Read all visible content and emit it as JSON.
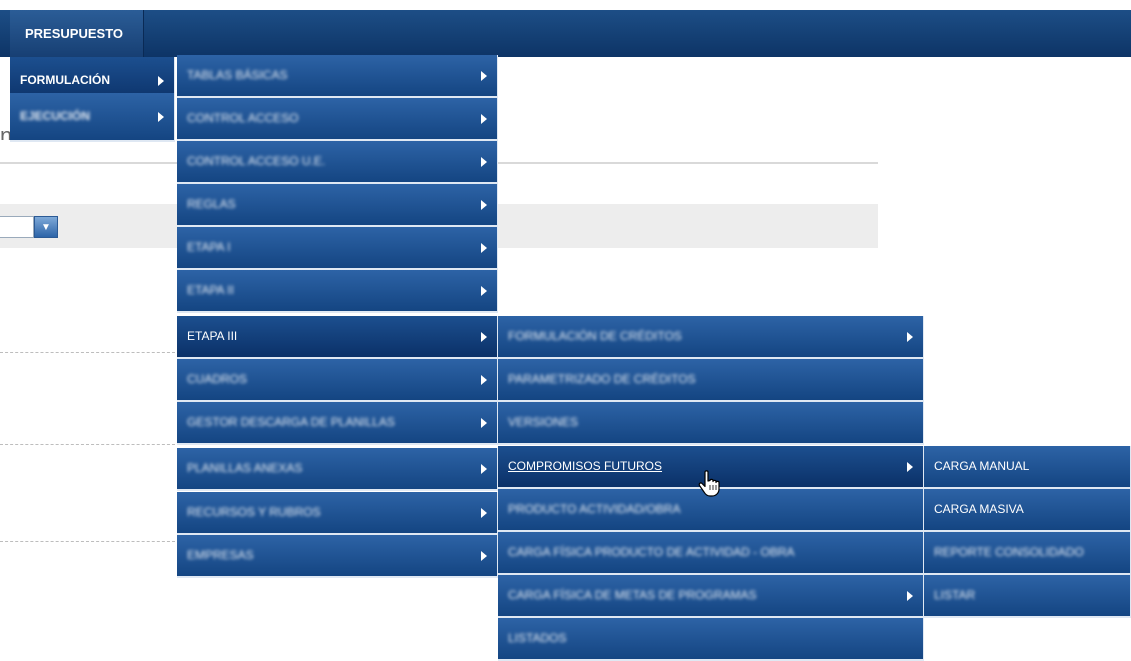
{
  "colors": {
    "menu_bg": "#1f5596",
    "banner_bg": "#123d73",
    "menu_text": "#ffffff"
  },
  "topbar": {
    "tab_label": "PRESUPUESTO"
  },
  "background_page": {
    "heading_fragment": "nperadas",
    "select_arrow_icon": "chevron-down-icon"
  },
  "menu_level1": [
    {
      "label": "FORMULACIÓN",
      "has_submenu": true,
      "active": true
    },
    {
      "label": "EJECUCIÓN",
      "has_submenu": true,
      "active": false
    }
  ],
  "menu_level2": [
    {
      "label": "TABLAS BÁSICAS",
      "has_submenu": true
    },
    {
      "label": "CONTROL ACCESO",
      "has_submenu": true
    },
    {
      "label": "CONTROL ACCESO U.E.",
      "has_submenu": true
    },
    {
      "label": "REGLAS",
      "has_submenu": true
    },
    {
      "label": "ETAPA I",
      "has_submenu": true
    },
    {
      "label": "ETAPA II",
      "has_submenu": true
    },
    {
      "label": "ETAPA III",
      "has_submenu": true,
      "active": true
    },
    {
      "label": "CUADROS",
      "has_submenu": true
    },
    {
      "label": "GESTOR DESCARGA DE PLANILLAS",
      "has_submenu": true
    },
    {
      "label": "PLANILLAS ANEXAS",
      "has_submenu": true
    },
    {
      "label": "RECURSOS Y RUBROS",
      "has_submenu": true
    },
    {
      "label": "EMPRESAS",
      "has_submenu": true
    }
  ],
  "menu_level3": [
    {
      "label": "FORMULACIÓN DE CRÉDITOS",
      "has_submenu": true
    },
    {
      "label": "PARAMETRIZADO DE CRÉDITOS",
      "has_submenu": false
    },
    {
      "label": "VERSIONES",
      "has_submenu": false
    },
    {
      "label": "COMPROMISOS FUTUROS",
      "has_submenu": true,
      "active": true
    },
    {
      "label": "PRODUCTO ACTIVIDAD/OBRA",
      "has_submenu": false
    },
    {
      "label": "CARGA FÍSICA PRODUCTO DE ACTIVIDAD - OBRA",
      "has_submenu": false
    },
    {
      "label": "CARGA FÍSICA DE METAS DE PROGRAMAS",
      "has_submenu": true
    },
    {
      "label": "LISTADOS",
      "has_submenu": false
    }
  ],
  "menu_level4": [
    {
      "label": "CARGA MANUAL"
    },
    {
      "label": "CARGA MASIVA"
    },
    {
      "label": "REPORTE CONSOLIDADO"
    },
    {
      "label": "LISTAR"
    }
  ]
}
